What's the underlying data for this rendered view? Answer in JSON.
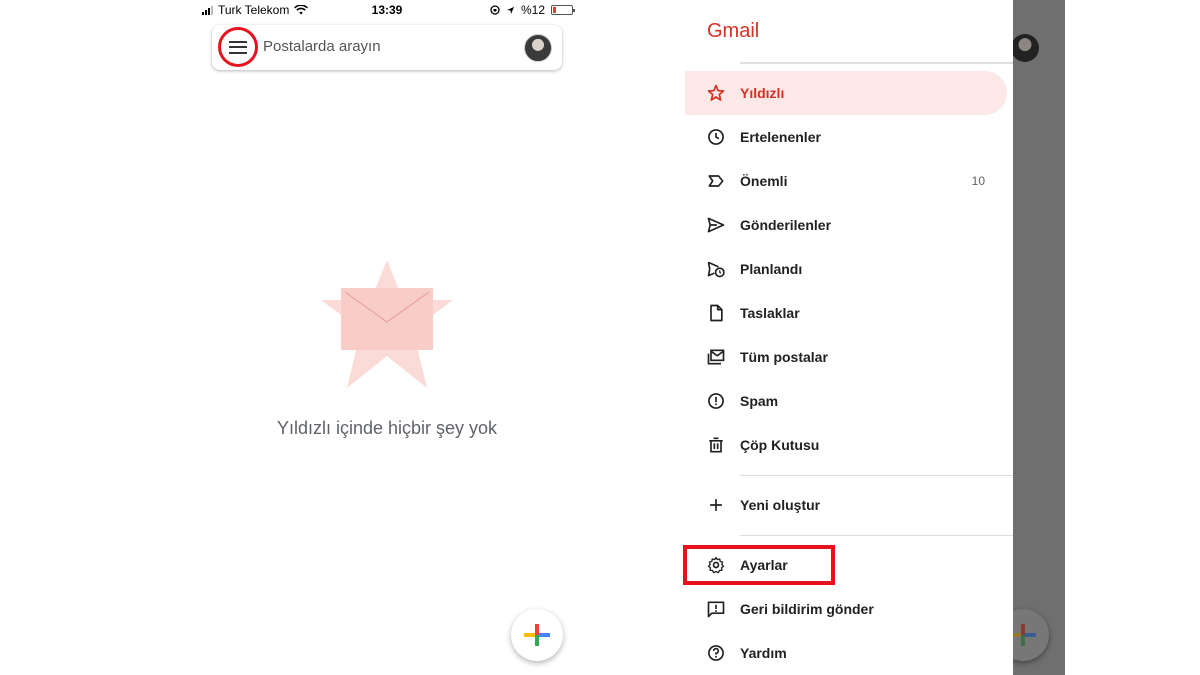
{
  "status_bar": {
    "carrier": "Turk Telekom",
    "time": "13:39",
    "battery": "%12"
  },
  "search": {
    "placeholder": "Postalarda arayın"
  },
  "empty_state": {
    "message": "Yıldızlı içinde hiçbir şey yok"
  },
  "drawer": {
    "title": "Gmail",
    "items": [
      {
        "label": "Yıldızlı",
        "icon": "star-icon",
        "active": true
      },
      {
        "label": "Ertelenenler",
        "icon": "clock-icon"
      },
      {
        "label": "Önemli",
        "icon": "important-icon",
        "count": "10"
      },
      {
        "label": "Gönderilenler",
        "icon": "send-icon"
      },
      {
        "label": "Planlandı",
        "icon": "scheduled-send-icon"
      },
      {
        "label": "Taslaklar",
        "icon": "draft-icon"
      },
      {
        "label": "Tüm postalar",
        "icon": "all-mail-icon"
      },
      {
        "label": "Spam",
        "icon": "spam-icon"
      },
      {
        "label": "Çöp Kutusu",
        "icon": "trash-icon"
      }
    ],
    "create_label": "Yeni oluştur",
    "settings_label": "Ayarlar",
    "feedback_label": "Geri bildirim gönder",
    "help_label": "Yardım"
  },
  "colors": {
    "accent": "#d93025",
    "active_bg": "#fce8e6",
    "annotation_red": "#e8121e"
  }
}
